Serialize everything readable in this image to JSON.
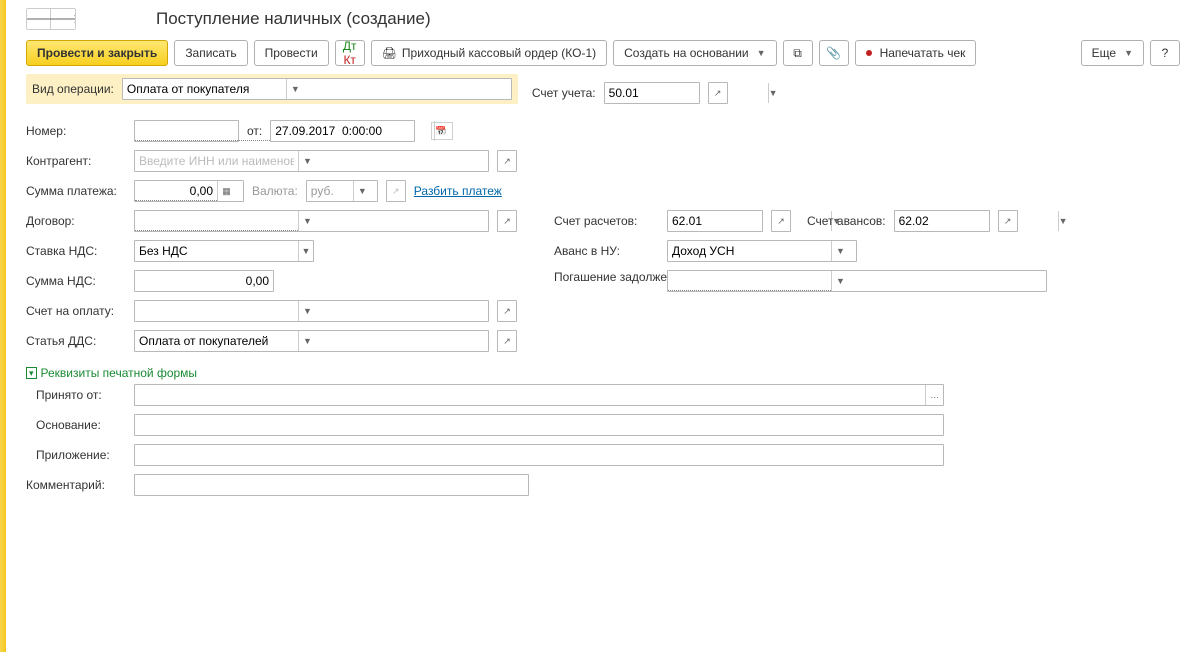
{
  "title": "Поступление наличных (создание)",
  "toolbar": {
    "post_close": "Провести и закрыть",
    "write": "Записать",
    "post": "Провести",
    "print_order": "Приходный кассовый ордер (КО-1)",
    "create_based": "Создать на основании",
    "print_check": "Напечатать чек",
    "more": "Еще",
    "help": "?"
  },
  "operation": {
    "label": "Вид операции:",
    "value": "Оплата от покупателя"
  },
  "account": {
    "label": "Счет учета:",
    "value": "50.01"
  },
  "number": {
    "label": "Номер:",
    "value": "",
    "from": "от:",
    "date": "27.09.2017  0:00:00"
  },
  "contragent": {
    "label": "Контрагент:",
    "placeholder": "Введите ИНН или наименование",
    "value": ""
  },
  "payment_sum": {
    "label": "Сумма платежа:",
    "value": "0,00"
  },
  "currency": {
    "label": "Валюта:",
    "value": "руб."
  },
  "split": "Разбить платеж",
  "contract": {
    "label": "Договор:",
    "value": ""
  },
  "settle_acc": {
    "label": "Счет расчетов:",
    "value": "62.01"
  },
  "advance_acc": {
    "label": "Счет авансов:",
    "value": "62.02"
  },
  "vat_rate": {
    "label": "Ставка НДС:",
    "value": "Без НДС"
  },
  "advance_nu": {
    "label": "Аванс в НУ:",
    "value": "Доход УСН"
  },
  "vat_sum": {
    "label": "Сумма НДС:",
    "value": "0,00"
  },
  "debt": {
    "label": "Погашение задолженности:",
    "value": ""
  },
  "invoice": {
    "label": "Счет на оплату:",
    "value": ""
  },
  "dds": {
    "label": "Статья ДДС:",
    "value": "Оплата от покупателей"
  },
  "section": "Реквизиты печатной формы",
  "received": {
    "label": "Принято от:",
    "value": ""
  },
  "basis": {
    "label": "Основание:",
    "value": ""
  },
  "attachment": {
    "label": "Приложение:",
    "value": ""
  },
  "comment": {
    "label": "Комментарий:",
    "value": ""
  }
}
